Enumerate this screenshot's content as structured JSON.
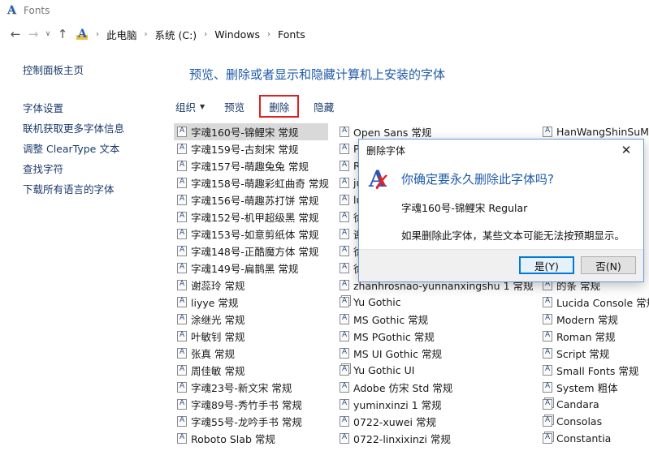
{
  "window": {
    "title": "Fonts"
  },
  "nav": {
    "back_icon": "back-arrow-icon",
    "forward_icon": "forward-arrow-icon",
    "recent_icon": "chevron-down-icon",
    "up_icon": "up-arrow-icon",
    "breadcrumbs": [
      "此电脑",
      "系统 (C:)",
      "Windows",
      "Fonts"
    ]
  },
  "left_pane": {
    "home": "控制面板主页",
    "links": [
      "字体设置",
      "联机获取更多字体信息",
      "调整 ClearType 文本",
      "查找字符",
      "下载所有语言的字体"
    ]
  },
  "main": {
    "title": "预览、删除或者显示和隐藏计算机上安装的字体"
  },
  "toolbar": {
    "organize": "组织",
    "preview": "预览",
    "delete": "删除",
    "hide": "隐藏"
  },
  "fonts": {
    "col1": [
      "字魂160号-锦鲤宋 常规",
      "字魂159号-古刻宋 常规",
      "字魂157号-萌趣兔兔 常规",
      "字魂158号-萌趣彩虹曲奇 常规",
      "字魂156号-萌趣苏打饼 常规",
      "字魂152号-机甲超级黑 常规",
      "字魂153号-如意剪纸体 常规",
      "字魂148号-正酷魔方体 常规",
      "字魂149号-扁鹊黑 常规",
      "谢蕊玲 常规",
      "liyye 常规",
      "涂继光 常规",
      "叶敏钊 常规",
      "张真 常规",
      "周佳敏 常规",
      "字魂23号-新文宋 常规",
      "字魂89号-秀竹手书 常规",
      "字魂55号-龙吟手书 常规",
      "Roboto Slab 常规"
    ],
    "col2": [
      "Open Sans 常规",
      "P",
      "R",
      "ju",
      "lu",
      "徐",
      "谢",
      "徐",
      "徐",
      "zhanhrosnao-yunnanxingshu 1 常规",
      "Yu Gothic",
      "MS Gothic 常规",
      "MS PGothic 常规",
      "MS UI Gothic 常规",
      "Yu Gothic UI",
      "Adobe 仿宋 Std 常规",
      "yuminxinzi 1 常规",
      "0722-xuwei 常规",
      "0722-linxixinzi 常规"
    ],
    "col3": [
      "HanWangShinSuMe",
      "",
      "",
      "",
      "",
      "",
      "ss",
      "",
      "",
      "的条 常规",
      "Lucida Console 常规",
      "Modern 常规",
      "Roman 常规",
      "Script 常规",
      "Small Fonts 常规",
      "System 粗体",
      "Candara",
      "Consolas",
      "Constantia"
    ]
  },
  "dialog": {
    "title": "删除字体",
    "question": "你确定要永久删除此字体吗?",
    "font_name": "字魂160号-锦鲤宋 Regular",
    "warning": "如果删除此字体，某些文本可能无法按预期显示。",
    "yes": "是(Y)",
    "no": "否(N)",
    "icon": "font-delete-icon"
  }
}
